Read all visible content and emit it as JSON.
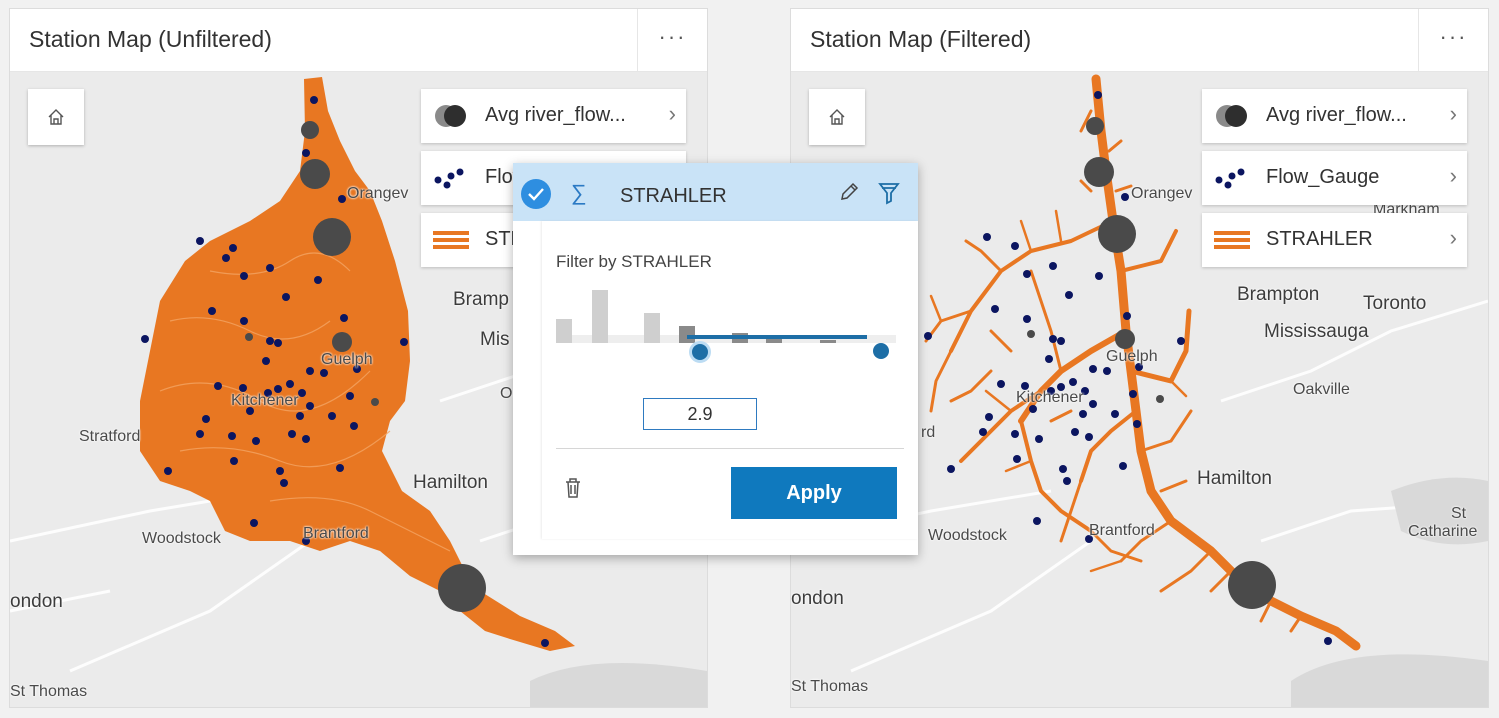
{
  "panels": [
    {
      "title": "Station Map (Unfiltered)",
      "menu_label": "···",
      "legend": [
        {
          "label": "Avg river_flow...",
          "icon": "proportional-symbol-icon"
        },
        {
          "label": "Flow_Gauge",
          "icon": "dot-cluster-icon"
        },
        {
          "label": "STRAHLER",
          "icon": "line-style-icon"
        }
      ],
      "places": {
        "orangeville": "Orangev",
        "brampton": "Bramp",
        "mississauga": "Mis",
        "oakville": "Oa",
        "guelph": "Guelph",
        "kitchener": "Kitchener",
        "stratford": "Stratford",
        "hamilton": "Hamilton",
        "woodstock": "Woodstock",
        "brantford": "Brantford",
        "london": "ondon",
        "st_thomas": "St Thomas"
      }
    },
    {
      "title": "Station Map (Filtered)",
      "menu_label": "···",
      "legend": [
        {
          "label": "Avg river_flow...",
          "icon": "proportional-symbol-icon"
        },
        {
          "label": "Flow_Gauge",
          "icon": "dot-cluster-icon"
        },
        {
          "label": "STRAHLER",
          "icon": "line-style-icon"
        }
      ],
      "places": {
        "orangeville": "Orangev",
        "markham": "Markham",
        "brampton": "Brampton",
        "toronto": "Toronto",
        "mississauga": "Mississauga",
        "oakville": "Oakville",
        "guelph": "Guelph",
        "kitchener": "Kitchener",
        "stratford": "rd",
        "hamilton": "Hamilton",
        "st_catharines_1": "St",
        "st_catharines_2": "Catharine",
        "woodstock": "Woodstock",
        "brantford": "Brantford",
        "london": "ondon",
        "st_thomas": "St Thomas"
      }
    }
  ],
  "filter_popup": {
    "field_name": "STRAHLER",
    "filter_label": "Filter by STRAHLER",
    "value": "2.9",
    "apply_label": "Apply",
    "slider_fraction": 0.56
  },
  "colors": {
    "river": "#e87722",
    "gauge": "#0b1560",
    "proportional": "#4a4a4a",
    "apply": "#0f79be",
    "slider": "#1d6ea6"
  }
}
